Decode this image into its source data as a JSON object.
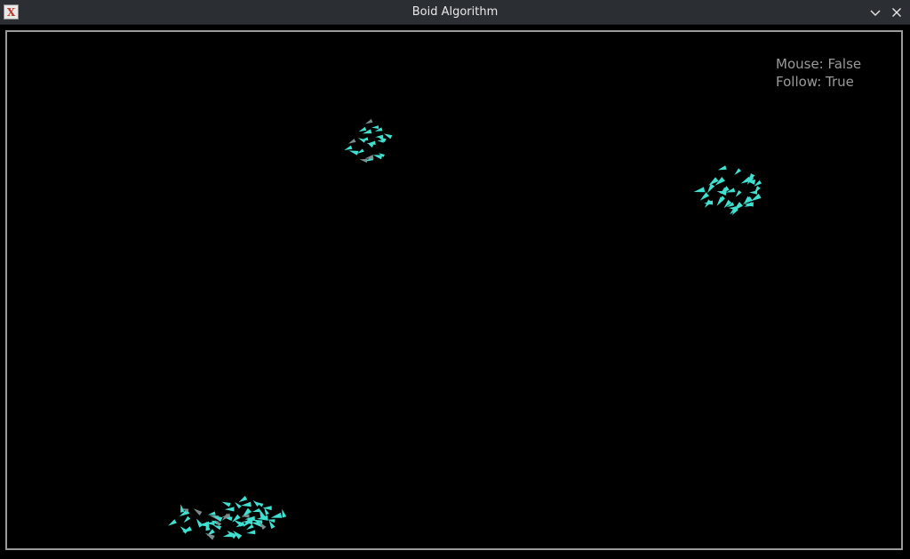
{
  "window": {
    "title": "Boid Algorithm",
    "icon": "app-x-icon",
    "buttons": [
      "chevron-down-icon",
      "close-icon"
    ]
  },
  "hud": {
    "mouse": "Mouse: False",
    "follow": "Follow: True"
  },
  "colors": {
    "boid": "#40e0d0",
    "boid_dim": "#7a8c8c",
    "border": "#9a9a9a",
    "hud_text": "#9a9a9a",
    "background": "#000000",
    "titlebar": "#2b2f33"
  }
}
